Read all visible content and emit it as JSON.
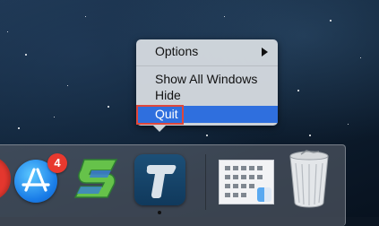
{
  "context_menu": {
    "options_label": "Options",
    "show_all_windows_label": "Show All Windows",
    "hide_label": "Hide",
    "quit_label": "Quit",
    "highlighted_item": "Quit",
    "highlight_color": "#2f6fde",
    "annotation_outline_color": "#e0473b"
  },
  "dock": {
    "items": [
      {
        "name": "red-app",
        "icon": "red-circle-icon"
      },
      {
        "name": "app-store",
        "icon": "app-store-icon",
        "badge": "4"
      },
      {
        "name": "slides-app",
        "icon": "green-blue-s-icon"
      },
      {
        "name": "t-app",
        "icon": "t-letter-icon",
        "running": true
      },
      {
        "name": "finder-window",
        "icon": "window-thumbnail-icon"
      },
      {
        "name": "trash",
        "icon": "trash-icon"
      }
    ],
    "badge_color": "#e8392f"
  }
}
